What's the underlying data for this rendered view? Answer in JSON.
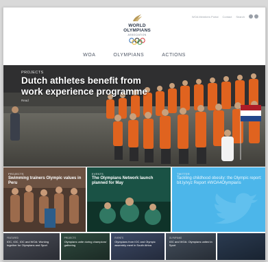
{
  "logo": {
    "line1": "WORLD",
    "line2": "OLYMPIANS",
    "line3": "ASSOCIATION"
  },
  "toplinks": [
    "WOA Members Portal",
    "Contact",
    "Search"
  ],
  "nav": [
    {
      "label": "WOA"
    },
    {
      "label": "OLYMPIANS"
    },
    {
      "label": "ACTIONS"
    }
  ],
  "hero": {
    "tag": "PROJECTS",
    "title": "Dutch athletes benefit from work experience programme",
    "read": "Read"
  },
  "tiles": [
    {
      "tag": "PROJECTS",
      "title": "Swimming trainers Olympic values in Peru"
    },
    {
      "tag": "EVENTS",
      "title": "The Olympians Network launch planned for May"
    },
    {
      "tag": "TWITTER",
      "title": "Tackling childhood obesity: the Olympic report: bit.ly/xyz Report #WOA4Olympians"
    }
  ],
  "bottom_tiles": [
    {
      "tag": "FEATURED",
      "title": "IOC, IOC, IOC and WOA: Working together for Olympians and Sport"
    },
    {
      "tag": "PROJECTS",
      "title": "Olympians unite during champions' gathering"
    },
    {
      "tag": "EVENTS",
      "title": "Olympians from IOC and Olympic assembly meet in South Africa"
    },
    {
      "tag": "OLYMPIANS",
      "title": "IOC and WOA: Olympians united in Sport"
    },
    {
      "tag": "",
      "title": ""
    }
  ],
  "colors": {
    "nav_text": "#4d5563",
    "twitter_tile": "#4cb6ea",
    "olympian_orange": "#e0631f"
  }
}
